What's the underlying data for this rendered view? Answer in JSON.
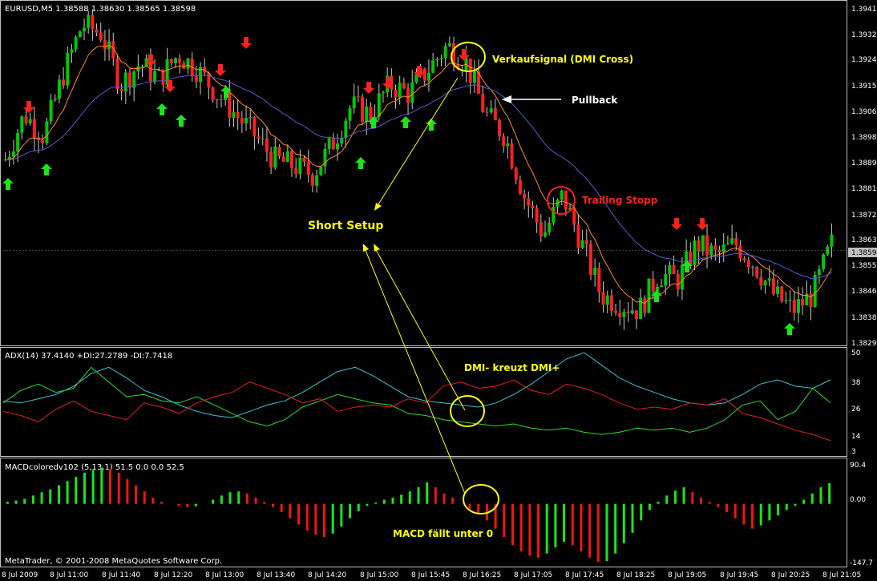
{
  "window": {
    "symbol_header": "EURUSD,M5  1.38588 1.38630 1.38565 1.38598",
    "copyright": "MetaTrader, © 2001-2008 MetaQuotes Software Corp."
  },
  "colors": {
    "background": "#000000",
    "frame": "#c0c0c0",
    "bull_candle": "#00c800",
    "bear_candle": "#ff2020",
    "ma_fast": "#ff8c28",
    "ma_slow": "#5a5ad2",
    "adx_line": "#3cc3d2",
    "plus_di": "#2ddc2d",
    "minus_di": "#e61e1e",
    "macd_pos": "#19e619",
    "macd_neg": "#f01414",
    "annotation_yellow": "#ffff00",
    "annotation_red": "#ff2020",
    "annotation_white": "#ffffff"
  },
  "panels": {
    "price": {
      "y_ticks": [
        "1.39410",
        "1.39325",
        "1.39240",
        "1.39150",
        "1.39065",
        "1.38980",
        "1.38895",
        "1.38810",
        "1.38720",
        "1.38635",
        "1.38550",
        "1.38465",
        "1.38380",
        "1.38295"
      ],
      "current_price": "1.38598"
    },
    "adx": {
      "label": "ADX(14) 37.4140 +DI:27.2789 -DI:7.7418",
      "y_ticks": [
        "50",
        "38",
        "26",
        "14",
        "3"
      ]
    },
    "macd": {
      "label": "MACDcoloredv102 (5,13,1) 51.5 0.0 0.0 52.5",
      "y_ticks": [
        "90.4",
        "0.00",
        "-147.7"
      ]
    }
  },
  "x_axis": {
    "labels": [
      "8 Jul 2009",
      "8 Jul 11:00",
      "8 Jul 11:40",
      "8 Jul 12:20",
      "8 Jul 13:00",
      "8 Jul 13:40",
      "8 Jul 14:20",
      "8 Jul 15:00",
      "8 Jul 15:45",
      "8 Jul 16:25",
      "8 Jul 17:05",
      "8 Jul 17:45",
      "8 Jul 18:25",
      "8 Jul 19:05",
      "8 Jul 19:45",
      "8 Jul 20:25",
      "8 Jul 21:05"
    ]
  },
  "annotations": {
    "sell_signal": "Verkaufsignal (DMI Cross)",
    "pullback": "Pullback",
    "trailing_stop": "Trailing Stopp",
    "short_setup": "Short Setup",
    "dmi_cross": "DMI- kreuzt DMI+",
    "macd_below_zero": "MACD fällt unter 0"
  },
  "chart_data": [
    {
      "type": "candlestick",
      "title": "EURUSD,M5",
      "x": [
        "8 Jul 2009",
        "8 Jul 11:00",
        "8 Jul 11:40",
        "8 Jul 12:20",
        "8 Jul 13:00",
        "8 Jul 13:40",
        "8 Jul 14:20",
        "8 Jul 15:00",
        "8 Jul 15:45",
        "8 Jul 16:25",
        "8 Jul 17:05",
        "8 Jul 17:45",
        "8 Jul 18:25",
        "8 Jul 19:05",
        "8 Jul 19:45",
        "8 Jul 20:25",
        "8 Jul 21:05"
      ],
      "close_path": [
        1.389,
        1.3905,
        1.3898,
        1.3918,
        1.3935,
        1.3932,
        1.3915,
        1.3922,
        1.3917,
        1.3925,
        1.392,
        1.3912,
        1.3905,
        1.3898,
        1.389,
        1.3888,
        1.3885,
        1.3895,
        1.3908,
        1.3905,
        1.3915,
        1.3912,
        1.392,
        1.3928,
        1.3922,
        1.3905,
        1.3898,
        1.3878,
        1.3865,
        1.3878,
        1.3862,
        1.3845,
        1.3842,
        1.384,
        1.3852,
        1.385,
        1.3862,
        1.3858,
        1.3862,
        1.3855,
        1.3845,
        1.384,
        1.3845,
        1.3862
      ],
      "ylim": [
        1.38295,
        1.3941
      ],
      "overlays": [
        "ma_fast",
        "ma_slow"
      ],
      "last": 1.38598
    },
    {
      "type": "line",
      "title": "ADX(14) 37.4140 +DI:27.2789 -DI:7.7418",
      "ylim": [
        3,
        50
      ],
      "series": [
        {
          "name": "ADX",
          "values": [
            27,
            26,
            28,
            30,
            34,
            40,
            43,
            38,
            32,
            29,
            25,
            22,
            20,
            19,
            22,
            25,
            27,
            31,
            36,
            41,
            43,
            39,
            34,
            29,
            27,
            26,
            25,
            24,
            26,
            30,
            35,
            41,
            47,
            50,
            44,
            38,
            34,
            31,
            28,
            26,
            25,
            26,
            30,
            35,
            37,
            34,
            33,
            37
          ]
        },
        {
          "name": "+DI",
          "values": [
            26,
            32,
            35,
            31,
            33,
            43,
            36,
            29,
            30,
            27,
            26,
            29,
            25,
            21,
            17,
            15,
            18,
            24,
            27,
            30,
            28,
            26,
            25,
            21,
            20,
            18,
            17,
            16,
            15,
            16,
            14,
            13,
            14,
            12,
            11,
            12,
            14,
            13,
            14,
            12,
            14,
            18,
            25,
            27,
            18,
            22,
            33,
            26
          ]
        },
        {
          "name": "-DI",
          "values": [
            22,
            20,
            17,
            23,
            27,
            22,
            20,
            18,
            26,
            24,
            21,
            26,
            29,
            31,
            36,
            33,
            30,
            26,
            28,
            22,
            24,
            25,
            24,
            28,
            26,
            34,
            36,
            33,
            34,
            37,
            32,
            30,
            35,
            33,
            30,
            26,
            23,
            24,
            23,
            26,
            25,
            28,
            21,
            19,
            16,
            13,
            11,
            8
          ]
        }
      ]
    },
    {
      "type": "bar",
      "title": "MACDcoloredv102 (5,13,1) 51.5 0.0 0.0 52.5",
      "ylim": [
        -147.7,
        90.4
      ],
      "values": [
        5,
        8,
        12,
        20,
        28,
        35,
        45,
        55,
        65,
        75,
        82,
        88,
        84,
        75,
        60,
        45,
        30,
        15,
        5,
        0,
        -5,
        -8,
        -6,
        0,
        10,
        20,
        28,
        30,
        25,
        15,
        5,
        -8,
        -20,
        -35,
        -50,
        -65,
        -75,
        -80,
        -72,
        -55,
        -35,
        -18,
        -5,
        3,
        10,
        15,
        22,
        30,
        40,
        52,
        40,
        25,
        15,
        0,
        -12,
        -25,
        -40,
        -60,
        -80,
        -100,
        -115,
        -125,
        -130,
        -120,
        -105,
        -92,
        -100,
        -115,
        -130,
        -140,
        -138,
        -120,
        -95,
        -70,
        -40,
        -15,
        5,
        20,
        32,
        40,
        28,
        15,
        5,
        -8,
        -20,
        -35,
        -50,
        -60,
        -52,
        -40,
        -28,
        -15,
        -5,
        10,
        25,
        40,
        50
      ]
    }
  ]
}
